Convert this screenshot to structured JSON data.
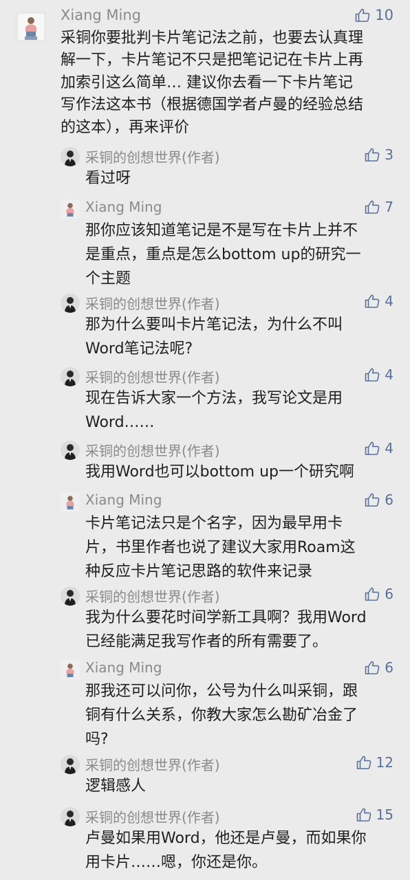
{
  "comments": [
    {
      "author": "Xiang Ming",
      "author_type": "user",
      "likes": "10",
      "text": "采铜你要批判卡片笔记法之前，也要去认真理\n解一下，卡片笔记不只是把笔记记在卡片上再\n加索引这么简单… 建议你去看一下卡片笔记\n写作法这本书（根据德国学者卢曼的经验总结\n的这本），再来评价"
    },
    {
      "author": "采铜的创想世界(作者)",
      "author_type": "author",
      "likes": "3",
      "text": "看过呀"
    },
    {
      "author": "Xiang Ming",
      "author_type": "user",
      "likes": "7",
      "text": "那你应该知道笔记是不是写在卡片上并不\n是重点，重点是怎么bottom up的研究一\n个主题"
    },
    {
      "author": "采铜的创想世界(作者)",
      "author_type": "author",
      "likes": "4",
      "text": "那为什么要叫卡片笔记法，为什么不叫\nWord笔记法呢?"
    },
    {
      "author": "采铜的创想世界(作者)",
      "author_type": "author",
      "likes": "4",
      "text": "现在告诉大家一个方法，我写论文是用\nWord……"
    },
    {
      "author": "采铜的创想世界(作者)",
      "author_type": "author",
      "likes": "4",
      "text": "我用Word也可以bottom up一个研究啊"
    },
    {
      "author": "Xiang Ming",
      "author_type": "user",
      "likes": "6",
      "text": "卡片笔记法只是个名字，因为最早用卡\n片，书里作者也说了建议大家用Roam这\n种反应卡片笔记思路的软件来记录"
    },
    {
      "author": "采铜的创想世界(作者)",
      "author_type": "author",
      "likes": "6",
      "text": "我为什么要花时间学新工具啊？我用Word\n已经能满足我写作者的所有需要了。"
    },
    {
      "author": "Xiang Ming",
      "author_type": "user",
      "likes": "6",
      "text": "那我还可以问你，公号为什么叫采铜，跟\n铜有什么关系，你教大家怎么勘矿冶金了\n吗?"
    },
    {
      "author": "采铜的创想世界(作者)",
      "author_type": "author",
      "likes": "12",
      "text": "逻辑感人"
    },
    {
      "author": "采铜的创想世界(作者)",
      "author_type": "author",
      "likes": "15",
      "text": "卢曼如果用Word，他还是卢曼，而如果你\n用卡片……嗯，你还是你。"
    }
  ],
  "icons": {
    "like": "thumbs-up-icon"
  },
  "colors": {
    "background": "#ebebeb",
    "name": "#8a8a8a",
    "text": "#1f1f1f",
    "like": "#5a6f98"
  }
}
